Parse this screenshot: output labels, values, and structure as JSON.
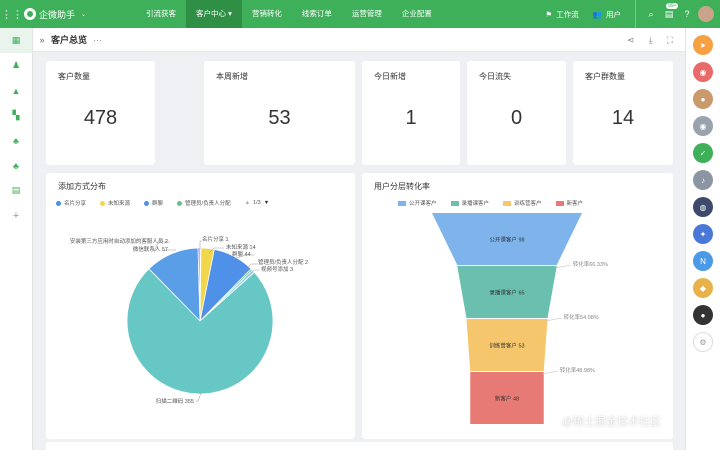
{
  "topbar": {
    "app_name": "企微助手",
    "nav": [
      "引流获客",
      "客户中心",
      "营销转化",
      "线索订单",
      "运营管理",
      "企业配置"
    ],
    "active_nav": "客户中心",
    "workflow_label": "工作流",
    "user_label": "用户",
    "notif_badge": "99+"
  },
  "header": {
    "title": "客户总览",
    "more": "···"
  },
  "stats": [
    {
      "label": "客户数量",
      "value": "478"
    },
    {
      "label": "本周新增",
      "value": "53"
    },
    {
      "label": "今日新增",
      "value": "1"
    },
    {
      "label": "今日流失",
      "value": "0"
    },
    {
      "label": "客户群数量",
      "value": "14"
    }
  ],
  "pie_card": {
    "title": "添加方式分布",
    "legend": [
      "名片分享",
      "未知来源",
      "群聊",
      "管理员/负责人分配"
    ],
    "pager": "1/3",
    "labels": {
      "install": "安装第三方应用时自动添加的客服人员 2",
      "wechat": "微信联系人 57",
      "card": "名片分享 1",
      "unknown": "未知来源 14",
      "group": "群聊 44",
      "admin": "管理员/负责人分配 2",
      "video": "视频号添加 3",
      "qr": "扫描二维码 355"
    }
  },
  "chart_data": [
    {
      "type": "pie",
      "title": "添加方式分布",
      "series": [
        {
          "name": "扫描二维码",
          "value": 355,
          "color": "#66c7c4"
        },
        {
          "name": "微信联系人",
          "value": 57,
          "color": "#5b9ee8"
        },
        {
          "name": "安装第三方应用时自动添加的客服人员",
          "value": 2,
          "color": "#7b6ff0"
        },
        {
          "name": "名片分享",
          "value": 1,
          "color": "#4a90e2"
        },
        {
          "name": "未知来源",
          "value": 14,
          "color": "#f2d64b"
        },
        {
          "name": "群聊",
          "value": 44,
          "color": "#4f90e8"
        },
        {
          "name": "管理员/负责人分配",
          "value": 2,
          "color": "#6bbf80"
        },
        {
          "name": "视频号添加",
          "value": 3,
          "color": "#9bd0f5"
        }
      ]
    },
    {
      "type": "funnel",
      "title": "用户分层转化率",
      "stages": [
        {
          "name": "公开课客户",
          "value": 98,
          "color": "#7eb3ec",
          "label": "公开课客户 98"
        },
        {
          "name": "录播课客户",
          "value": 65,
          "color": "#6bbfae",
          "label": "录播课客户 65"
        },
        {
          "name": "训练营客户",
          "value": 53,
          "color": "#f5c66c",
          "label": "训练营客户 53"
        },
        {
          "name": "新客户",
          "value": 48,
          "color": "#e77a74",
          "label": "新客户 48"
        }
      ],
      "rates": [
        "转化率66.33%",
        "转化率54.08%",
        "转化率48.98%"
      ]
    }
  ],
  "funnel_card": {
    "title": "用户分层转化率",
    "legend": [
      "公开课客户",
      "录播课客户",
      "训练营客户",
      "新客户"
    ]
  },
  "watermark": "@稀土掘金技术社区"
}
